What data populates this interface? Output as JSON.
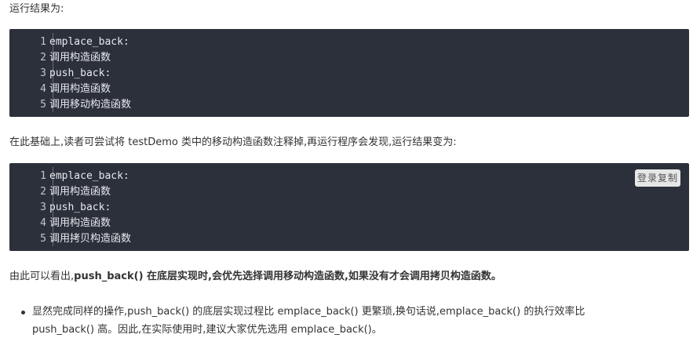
{
  "intro_text": "运行结果为:",
  "block1": {
    "lines": [
      {
        "num": "1",
        "code": "emplace_back:"
      },
      {
        "num": "2",
        "code": "调用构造函数"
      },
      {
        "num": "3",
        "code": "push_back:"
      },
      {
        "num": "4",
        "code": "调用构造函数"
      },
      {
        "num": "5",
        "code": "调用移动构造函数"
      }
    ]
  },
  "middle_text": "在此基础上,读者可尝试将 testDemo 类中的移动构造函数注释掉,再运行程序会发现,运行结果变为:",
  "block2": {
    "copy_label": "登录复制",
    "lines": [
      {
        "num": "1",
        "code": "emplace_back:"
      },
      {
        "num": "2",
        "code": "调用构造函数"
      },
      {
        "num": "3",
        "code": "push_back:"
      },
      {
        "num": "4",
        "code": "调用构造函数"
      },
      {
        "num": "5",
        "code": "调用拷贝构造函数"
      }
    ]
  },
  "conclusion": {
    "prefix": "由此可以看出,",
    "bold": "push_back() 在底层实现时,会优先选择调用移动构造函数,如果没有才会调用拷贝构造函数。"
  },
  "bullet": {
    "line1": "显然完成同样的操作,push_back() 的底层实现过程比 emplace_back() 更繁琐,换句话说,emplace_back() 的执行效率比",
    "line2": "push_back() 高。因此,在实际使用时,建议大家优先选用 emplace_back()。"
  }
}
